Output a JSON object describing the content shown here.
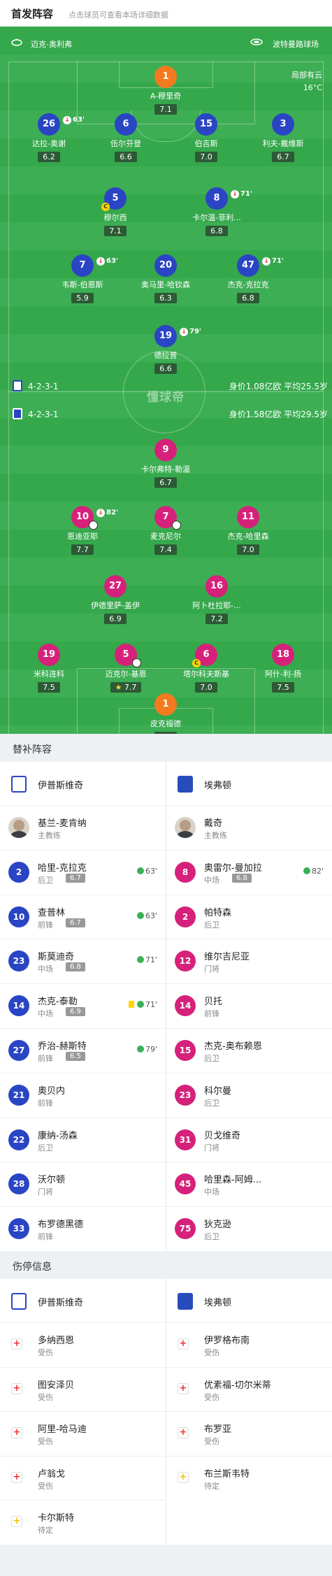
{
  "header": {
    "title": "首发阵容",
    "subtitle": "点击球员可查看本场详细数据"
  },
  "match": {
    "home_venue": "迈克-奥利弗",
    "away_venue": "波特曼路球场",
    "weather": "局部有云",
    "temp": "16°C"
  },
  "home": {
    "formation": "4-2-3-1",
    "value": "身价1.08亿欧",
    "age": "平均25.5岁"
  },
  "away": {
    "formation": "4-2-3-1",
    "value": "身价1.58亿欧",
    "age": "平均29.5岁"
  },
  "watermark": "懂球帝",
  "home_players": [
    {
      "num": "1",
      "name": "A-穆里奇",
      "rating": "7.1"
    },
    {
      "num": "26",
      "name": "达拉-奥谢",
      "rating": "6.2",
      "sub": "63'"
    },
    {
      "num": "6",
      "name": "伍尔芬登",
      "rating": "6.6"
    },
    {
      "num": "15",
      "name": "伯吉斯",
      "rating": "7.0"
    },
    {
      "num": "3",
      "name": "利夫-戴维斯",
      "rating": "6.7"
    },
    {
      "num": "5",
      "name": "穆尔西",
      "rating": "7.1",
      "cap": "C"
    },
    {
      "num": "8",
      "name": "卡尔温-菲利...",
      "rating": "6.8",
      "sub": "71'"
    },
    {
      "num": "7",
      "name": "韦斯-伯恩斯",
      "rating": "5.9",
      "sub": "63'"
    },
    {
      "num": "20",
      "name": "奥马里-哈钦森",
      "rating": "6.3"
    },
    {
      "num": "47",
      "name": "杰克-克拉克",
      "rating": "6.8",
      "sub": "71'"
    },
    {
      "num": "19",
      "name": "德拉普",
      "rating": "6.6",
      "sub": "79'"
    }
  ],
  "away_players": [
    {
      "num": "9",
      "name": "卡尔弗特-勒温",
      "rating": "6.7"
    },
    {
      "num": "10",
      "name": "恩迪亚耶",
      "rating": "7.7",
      "sub": "82'"
    },
    {
      "num": "7",
      "name": "麦克尼尔",
      "rating": "7.4"
    },
    {
      "num": "11",
      "name": "杰克-哈里森",
      "rating": "7.0"
    },
    {
      "num": "27",
      "name": "伊德里萨-盖伊",
      "rating": "6.9"
    },
    {
      "num": "16",
      "name": "阿卜杜拉耶-...",
      "rating": "7.2"
    },
    {
      "num": "19",
      "name": "米科连科",
      "rating": "7.5"
    },
    {
      "num": "5",
      "name": "迈克尔-基恩",
      "rating": "7.7",
      "star": true
    },
    {
      "num": "6",
      "name": "塔尔科夫斯基",
      "rating": "7.0",
      "cap": "C"
    },
    {
      "num": "18",
      "name": "阿什-利-扬",
      "rating": "7.5"
    },
    {
      "num": "1",
      "name": "皮克福德",
      "rating": "6.7"
    }
  ],
  "subs_section": "替补阵容",
  "teams": {
    "home": "伊普斯维奇",
    "away": "埃弗顿"
  },
  "subs_home": [
    {
      "name": "基兰-麦肯纳",
      "pos": "主教练",
      "coach": true
    },
    {
      "num": "2",
      "name": "哈里-克拉克",
      "pos": "后卫",
      "rating": "6.7",
      "in": "63'"
    },
    {
      "num": "10",
      "name": "查普林",
      "pos": "前锋",
      "rating": "6.7",
      "in": "63'"
    },
    {
      "num": "23",
      "name": "斯莫迪奇",
      "pos": "中场",
      "rating": "6.8",
      "in": "71'"
    },
    {
      "num": "14",
      "name": "杰克-泰勒",
      "pos": "中场",
      "rating": "6.9",
      "in": "71'",
      "yellow": true
    },
    {
      "num": "27",
      "name": "乔治-赫斯特",
      "pos": "前锋",
      "rating": "6.5",
      "in": "79'"
    },
    {
      "num": "21",
      "name": "奥贝内",
      "pos": "前锋"
    },
    {
      "num": "22",
      "name": "康纳-汤森",
      "pos": "后卫"
    },
    {
      "num": "28",
      "name": "沃尔顿",
      "pos": "门将"
    },
    {
      "num": "33",
      "name": "布罗德黑德",
      "pos": "前锋"
    }
  ],
  "subs_away": [
    {
      "name": "戴奇",
      "pos": "主教练",
      "coach": true
    },
    {
      "num": "8",
      "name": "奥雷尔-曼加拉",
      "pos": "中场",
      "rating": "6.8",
      "in": "82'"
    },
    {
      "num": "2",
      "name": "帕特森",
      "pos": "后卫"
    },
    {
      "num": "12",
      "name": "维尔吉尼亚",
      "pos": "门将"
    },
    {
      "num": "14",
      "name": "贝托",
      "pos": "前锋"
    },
    {
      "num": "15",
      "name": "杰克-奥布赖恩",
      "pos": "后卫"
    },
    {
      "num": "23",
      "name": "科尔曼",
      "pos": "后卫"
    },
    {
      "num": "31",
      "name": "贝戈维奇",
      "pos": "门将"
    },
    {
      "num": "45",
      "name": "哈里森-阿姆...",
      "pos": "中场"
    },
    {
      "num": "75",
      "name": "狄克逊",
      "pos": "后卫"
    }
  ],
  "injury_section": "伤停信息",
  "inj_home": [
    {
      "name": "多纳西恩",
      "status": "受伤"
    },
    {
      "name": "图安泽贝",
      "status": "受伤"
    },
    {
      "name": "阿里-哈马迪",
      "status": "受伤"
    },
    {
      "name": "卢翁戈",
      "status": "受伤"
    },
    {
      "name": "卡尔斯特",
      "status": "待定",
      "doubt": true
    }
  ],
  "inj_away": [
    {
      "name": "伊罗格布南",
      "status": "受伤"
    },
    {
      "name": "优素福-切尔米蒂",
      "status": "受伤"
    },
    {
      "name": "布罗亚",
      "status": "受伤"
    },
    {
      "name": "布兰斯韦特",
      "status": "待定",
      "doubt": true
    }
  ],
  "colors": {
    "home": "#2a45c4",
    "away": "#d6217b",
    "gk": "#f37a1f",
    "pitch": "#35a84c"
  }
}
